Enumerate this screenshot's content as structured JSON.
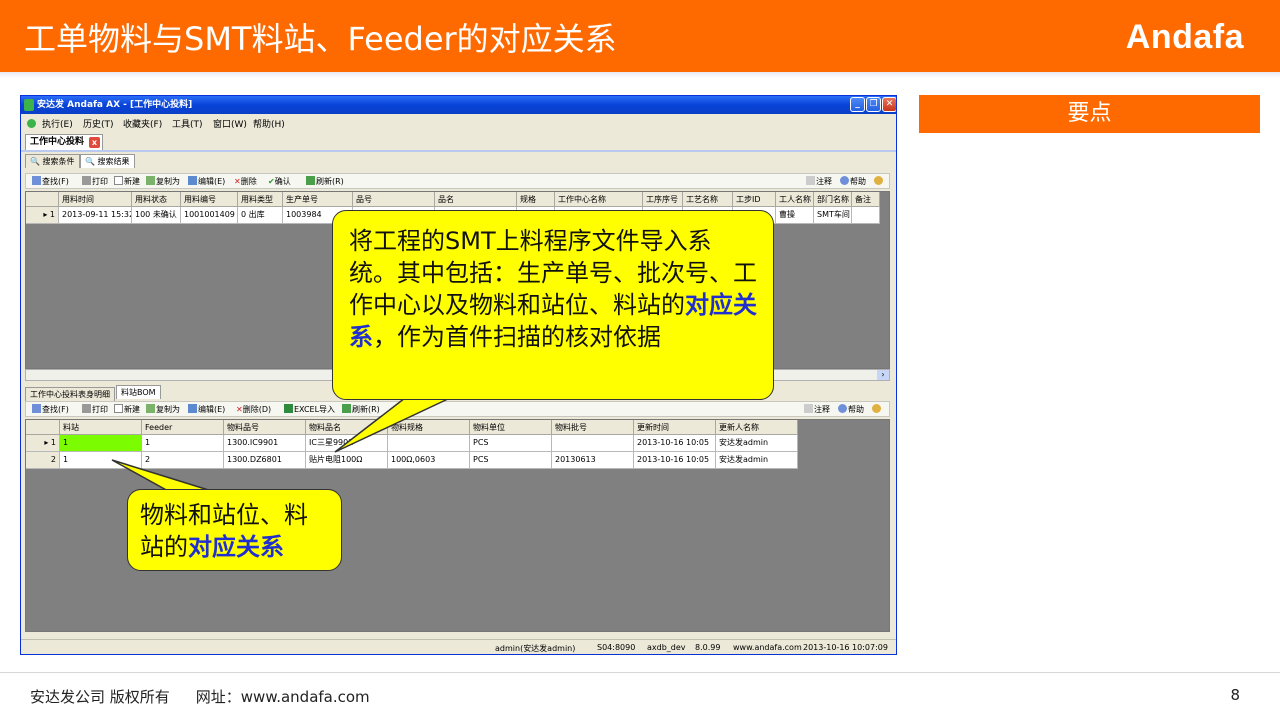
{
  "slide": {
    "title": "工单物料与SMT料站、Feeder的对应关系",
    "logo": "Andafa",
    "key_points_label": "要点",
    "footer": {
      "copyright": "安达发公司 版权所有",
      "website": "网址：www.andafa.com",
      "page": "8"
    }
  },
  "window": {
    "title": "安达发 Andafa AX - [工作中心投料]",
    "menu": [
      "执行(E)",
      "历史(T)",
      "收藏夹(F)",
      "工具(T)",
      "窗口(W)",
      "帮助(H)"
    ],
    "doc_tab": "工作中心投料",
    "panel_tabs": [
      "搜索条件",
      "搜索结果"
    ],
    "toolbar_top": [
      "查找(F)",
      "打印",
      "新建",
      "复制为",
      "编辑(E)",
      "删除",
      "确认",
      "刷新(R)"
    ],
    "toolbar_top_right": [
      "注释",
      "帮助"
    ],
    "top_grid": {
      "columns": [
        "用料时间",
        "用料状态",
        "用料编号",
        "用料类型",
        "生产单号",
        "品号",
        "品名",
        "规格",
        "工作中心名称",
        "工序序号",
        "工艺名称",
        "工步ID",
        "工人名称",
        "部门名称",
        "备注"
      ],
      "rows": [
        {
          "index": "1",
          "cells": [
            "2013-09-11 15:32",
            "100 未确认",
            "1001001409",
            "0 出库",
            "1003984",
            "",
            "",
            "",
            "",
            "",
            "",
            "",
            "曹操",
            "SMT车间",
            ""
          ]
        }
      ]
    },
    "bottom_tabs": [
      "工作中心投料表身明细",
      "料站BOM"
    ],
    "toolbar_bottom": [
      "查找(F)",
      "打印",
      "新建",
      "复制为",
      "编辑(E)",
      "删除(D)",
      "EXCEL导入",
      "刷新(R)"
    ],
    "toolbar_bottom_right": [
      "注释",
      "帮助"
    ],
    "bottom_grid": {
      "columns": [
        "料站",
        "Feeder",
        "物料品号",
        "物料品名",
        "物料规格",
        "物料单位",
        "物料批号",
        "更新时间",
        "更新人名称"
      ],
      "rows": [
        {
          "index": "1",
          "cells": [
            "1",
            "1",
            "1300.IC9901",
            "IC三星9901",
            "",
            "PCS",
            "",
            "2013-10-16 10:05",
            "安达发admin"
          ]
        },
        {
          "index": "2",
          "cells": [
            "1",
            "2",
            "1300.DZ6801",
            "贴片电阻100Ω",
            "100Ω,0603",
            "PCS",
            "20130613",
            "2013-10-16 10:05",
            "安达发admin"
          ]
        }
      ]
    },
    "status": [
      "admin(安达发admin)",
      "S04:8090",
      "axdb_dev",
      "8.0.99",
      "www.andafa.com",
      "2013-10-16 10:07:09"
    ]
  },
  "callouts": {
    "top": {
      "before": "将工程的SMT上料程序文件导入系统。其中包括：生产单号、批次号、工作中心以及物料和站位、料站的",
      "highlight": "对应关系",
      "after": "，作为首件扫描的核对依据"
    },
    "bottom": {
      "before": "物料和站位、料站的",
      "highlight": "对应关系"
    }
  },
  "colors": {
    "header": "#ff6a00",
    "callout_fill": "#ffff00",
    "highlight_text": "#1f2fd0",
    "selected_cell": "#7cfc00"
  }
}
